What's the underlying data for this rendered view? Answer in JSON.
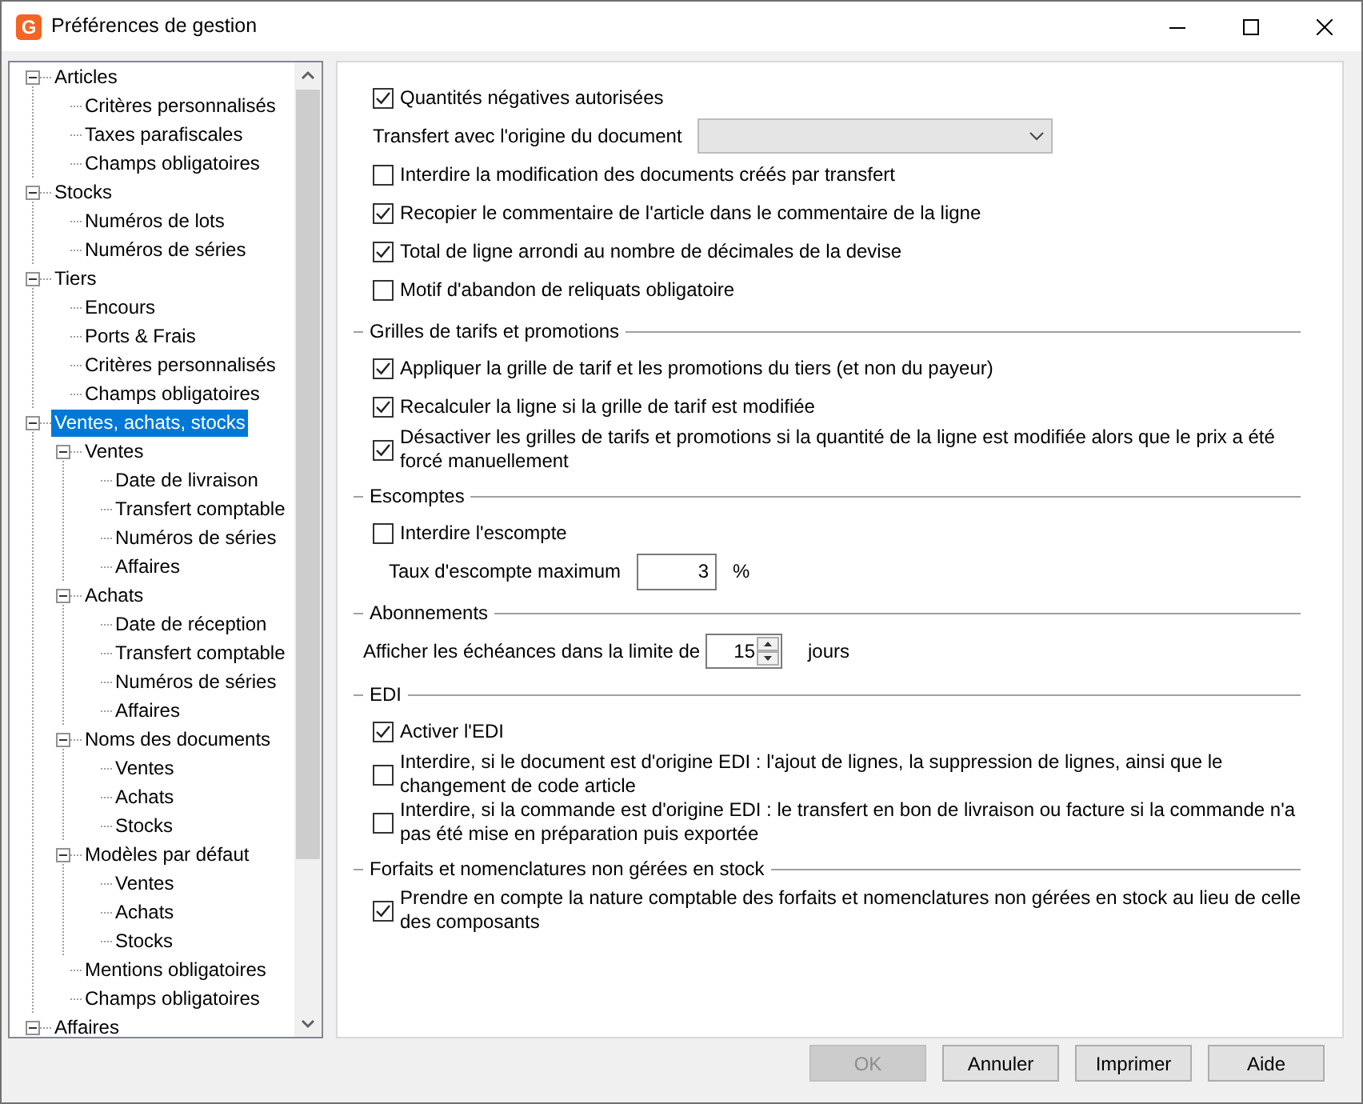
{
  "window": {
    "title": "Préférences de gestion",
    "icon_text": "G"
  },
  "tree": [
    {
      "label": "Articles",
      "selected": false,
      "expanded": true,
      "children": [
        {
          "label": "Critères personnalisés",
          "selected": false
        },
        {
          "label": "Taxes parafiscales",
          "selected": false
        },
        {
          "label": "Champs obligatoires",
          "selected": false
        }
      ]
    },
    {
      "label": "Stocks",
      "selected": false,
      "expanded": true,
      "children": [
        {
          "label": "Numéros de lots",
          "selected": false
        },
        {
          "label": "Numéros de séries",
          "selected": false
        }
      ]
    },
    {
      "label": "Tiers",
      "selected": false,
      "expanded": true,
      "children": [
        {
          "label": "Encours",
          "selected": false
        },
        {
          "label": "Ports & Frais",
          "selected": false
        },
        {
          "label": "Critères personnalisés",
          "selected": false
        },
        {
          "label": "Champs obligatoires",
          "selected": false
        }
      ]
    },
    {
      "label": "Ventes, achats, stocks",
      "selected": true,
      "expanded": true,
      "children": [
        {
          "label": "Ventes",
          "selected": false,
          "expanded": true,
          "children": [
            {
              "label": "Date de livraison",
              "selected": false
            },
            {
              "label": "Transfert comptable",
              "selected": false
            },
            {
              "label": "Numéros de séries",
              "selected": false
            },
            {
              "label": "Affaires",
              "selected": false
            }
          ]
        },
        {
          "label": "Achats",
          "selected": false,
          "expanded": true,
          "children": [
            {
              "label": "Date de réception",
              "selected": false
            },
            {
              "label": "Transfert comptable",
              "selected": false
            },
            {
              "label": "Numéros de séries",
              "selected": false
            },
            {
              "label": "Affaires",
              "selected": false
            }
          ]
        },
        {
          "label": "Noms des documents",
          "selected": false,
          "expanded": true,
          "children": [
            {
              "label": "Ventes",
              "selected": false
            },
            {
              "label": "Achats",
              "selected": false
            },
            {
              "label": "Stocks",
              "selected": false
            }
          ]
        },
        {
          "label": "Modèles par défaut",
          "selected": false,
          "expanded": true,
          "children": [
            {
              "label": "Ventes",
              "selected": false
            },
            {
              "label": "Achats",
              "selected": false
            },
            {
              "label": "Stocks",
              "selected": false
            }
          ]
        },
        {
          "label": "Mentions obligatoires",
          "selected": false
        },
        {
          "label": "Champs obligatoires",
          "selected": false
        }
      ]
    },
    {
      "label": "Affaires",
      "selected": false,
      "expanded": true
    }
  ],
  "sections": [
    {
      "items": [
        {
          "kind": "checkbox",
          "label": "Quantités négatives autorisées",
          "checked": true
        },
        {
          "kind": "dropdown",
          "label": "Transfert avec l'origine du document",
          "disabled": true
        },
        {
          "kind": "checkbox",
          "label": "Interdire la modification des documents créés par transfert",
          "checked": false
        },
        {
          "kind": "checkbox",
          "label": "Recopier le commentaire de l'article dans le commentaire de la ligne",
          "checked": true
        },
        {
          "kind": "checkbox",
          "label": "Total de ligne arrondi au nombre de décimales de la devise",
          "checked": true
        },
        {
          "kind": "checkbox",
          "label": "Motif d'abandon de reliquats obligatoire",
          "checked": false
        }
      ]
    },
    {
      "title": "Grilles de tarifs et promotions",
      "items": [
        {
          "kind": "checkbox",
          "label": "Appliquer la grille de tarif et les promotions du tiers (et non du payeur)",
          "checked": true
        },
        {
          "kind": "checkbox",
          "label": "Recalculer la ligne si la grille de tarif est modifiée",
          "checked": true
        },
        {
          "kind": "checkbox",
          "label": "Désactiver les grilles de tarifs et promotions si la quantité de la ligne est modifiée alors que le prix a été forcé manuellement",
          "checked": true
        }
      ]
    },
    {
      "title": "Escomptes",
      "items": [
        {
          "kind": "checkbox",
          "label": "Interdire l'escompte",
          "checked": false
        },
        {
          "kind": "number",
          "label": "Taux d'escompte maximum",
          "value": "3",
          "unit": "%"
        }
      ]
    },
    {
      "title": "Abonnements",
      "items": [
        {
          "kind": "spinner",
          "label": "Afficher les échéances dans la limite de",
          "value": "15",
          "unit": "jours"
        }
      ]
    },
    {
      "title": "EDI",
      "items": [
        {
          "kind": "checkbox",
          "label": "Activer l'EDI",
          "checked": true
        },
        {
          "kind": "checkbox",
          "label": "Interdire, si le document est d'origine EDI : l'ajout de lignes, la suppression de lignes, ainsi que le changement de code article",
          "checked": false
        },
        {
          "kind": "checkbox",
          "label": "Interdire, si la commande est d'origine EDI : le transfert en bon de livraison ou facture si la commande n'a pas été mise en préparation puis exportée",
          "checked": false
        }
      ]
    },
    {
      "title": "Forfaits et nomenclatures non gérées en stock",
      "items": [
        {
          "kind": "checkbox",
          "label": "Prendre en compte la nature comptable des forfaits et nomenclatures non gérées en stock au lieu de celle des composants",
          "checked": true
        }
      ]
    }
  ],
  "buttons": [
    {
      "label": "OK",
      "disabled": true
    },
    {
      "label": "Annuler",
      "disabled": false
    },
    {
      "label": "Imprimer",
      "disabled": false
    },
    {
      "label": "Aide",
      "disabled": false
    }
  ]
}
